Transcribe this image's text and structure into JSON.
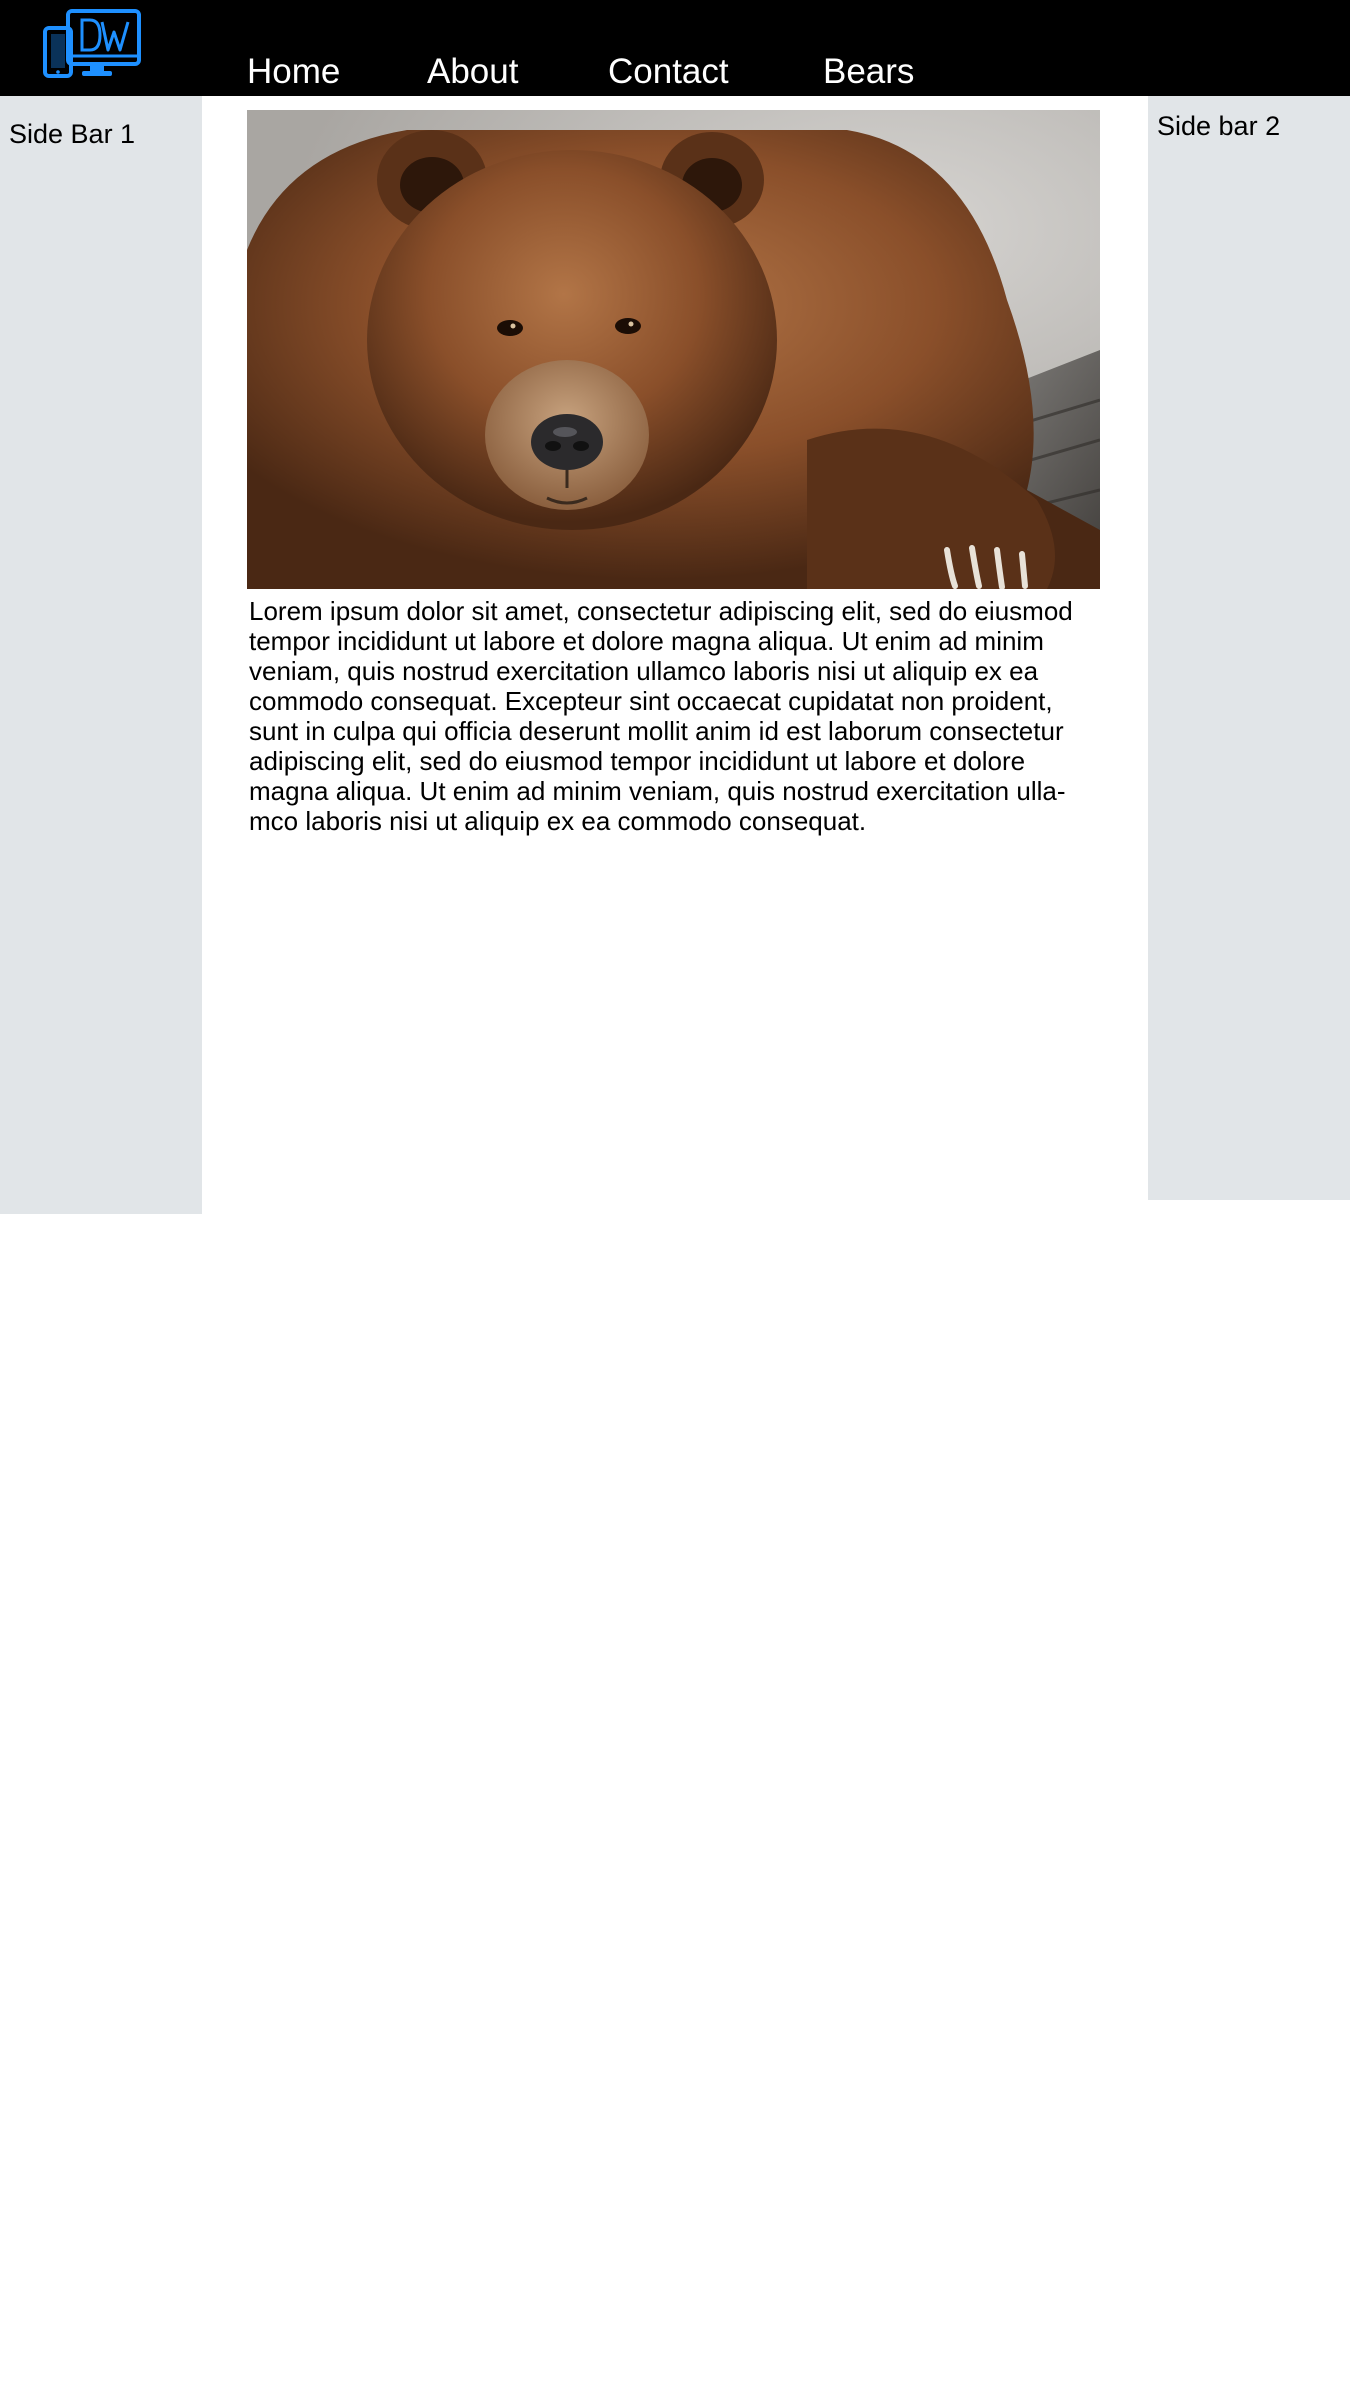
{
  "header": {
    "logo_icon": "devices-dw-logo-icon",
    "logo_text": "DW",
    "logo_color": "#1e90ff",
    "background_color": "#000000",
    "nav": [
      {
        "label": "Home"
      },
      {
        "label": "About"
      },
      {
        "label": "Contact"
      },
      {
        "label": "Bears"
      }
    ]
  },
  "sidebar_left": {
    "title": "Side Bar 1",
    "background_color": "#e1e5e8"
  },
  "sidebar_right": {
    "title": "Side bar 2",
    "background_color": "#e1e5e8"
  },
  "main": {
    "image_subject": "brown-bear-photo",
    "paragraph": "Lorem ipsum dolor sit amet, consectetur adipiscing elit, sed do eiusmod tempor incididunt ut labore et dolore magna aliqua. Ut enim ad minim veniam, quis nostrud exercitation ullamco laboris nisi ut aliquip ex ea commodo consequat. Excepteur sint occaecat cupidatat non proident, sunt in culpa qui officia deserunt mollit anim id est laborum consectetur adipiscing elit, sed do eiusmod tempor incididunt ut labore et dolore magna aliqua. Ut enim ad minim veniam, quis nostrud exercitation ulla-mco laboris nisi ut aliquip ex ea commodo consequat."
  }
}
